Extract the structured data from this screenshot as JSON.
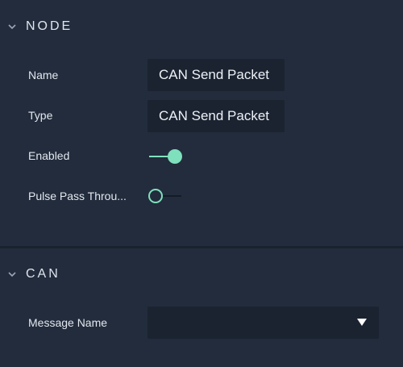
{
  "sections": {
    "node": {
      "title": "NODE",
      "rows": {
        "name": {
          "label": "Name",
          "value": "CAN Send Packet"
        },
        "type": {
          "label": "Type",
          "value": "CAN Send Packet"
        },
        "enabled": {
          "label": "Enabled",
          "state": "on"
        },
        "pulse": {
          "label": "Pulse Pass Throu...",
          "state": "off"
        }
      }
    },
    "can": {
      "title": "CAN",
      "rows": {
        "message_name": {
          "label": "Message Name",
          "value": ""
        }
      }
    }
  },
  "colors": {
    "panel_bg": "#222c3c",
    "field_bg": "#1b2331",
    "accent": "#7fe0bd"
  },
  "icons": {
    "section_toggle": "chevron-down-icon",
    "select_caret": "caret-down-icon"
  }
}
